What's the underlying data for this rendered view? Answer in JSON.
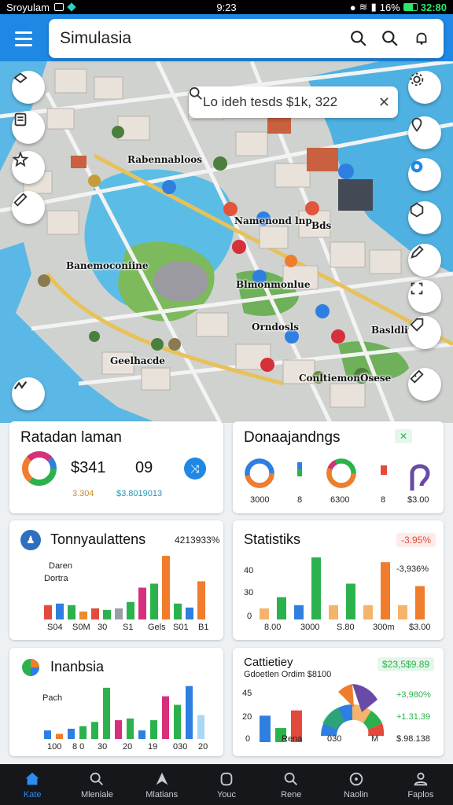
{
  "status": {
    "carrier": "Sroyulam",
    "center": "9:23",
    "battery": "16%",
    "clock": "32:80"
  },
  "app": {
    "title": "Simulasia"
  },
  "map_search": {
    "query": "Lo ideh tesds  $1k, 322"
  },
  "map_labels": {
    "l1": "Rabennabloos",
    "l2": "Namenond lnp",
    "l3": "Banemoconiine",
    "l4": "Blmonmonlue",
    "l5": "Orndosls",
    "l6": "Geelhacde",
    "l7": "Conltiemonthe",
    "l8": "Osese",
    "l9": "Basldline",
    "l10": "Bds"
  },
  "cards": {
    "radan": {
      "title": "Ratadan laman",
      "value": "$341",
      "value2": "09",
      "sub1": "3.304",
      "sub2": "$3.8019013"
    },
    "dona": {
      "title": "Donaajandngs",
      "labels": [
        "3000",
        "8",
        "6300",
        "8",
        "$3.00"
      ]
    },
    "tonny": {
      "title": "Tonnyaulattens",
      "chip": "4213933%",
      "legend1": "Daren",
      "legend2": "Dortra",
      "xlabels": [
        "S04",
        "S0M",
        "30",
        "S1",
        "Gels",
        "S01",
        "B1"
      ]
    },
    "stats": {
      "title": "Statistiks",
      "chip": "-3.95%",
      "pct": "-3,936%",
      "ylabels": [
        "40",
        "30",
        "0"
      ],
      "xlabels": [
        "8.00",
        "3000",
        "S.80",
        "300m",
        "$3.00"
      ]
    },
    "indon": {
      "title": "Inanbsia",
      "ylabel": "Pach",
      "xlabels": [
        "100",
        "8 0",
        "30",
        "20",
        "19",
        "030",
        "20"
      ]
    },
    "catt": {
      "title": "Cattietiey",
      "sub": "Gdoetlen Ordim $8100",
      "chip": "$23,5$9.89",
      "ylabels": [
        "45",
        "20",
        "0"
      ],
      "xlabels": [
        "Rena",
        "030",
        "M"
      ],
      "pcts": [
        "+3,980%",
        "+1.31.39",
        "$.98.138"
      ]
    }
  },
  "chart_data": [
    {
      "type": "bar",
      "title": "Tonnyaulattens",
      "series": [
        {
          "values": [
            18,
            20,
            18,
            10,
            14,
            12,
            14,
            22,
            40,
            45,
            80,
            20,
            15,
            48
          ]
        }
      ],
      "colors": [
        "#e24b3b",
        "#2f7fe0",
        "#2bb24c",
        "#e88c2c",
        "#e24b3b",
        "#2bb24c",
        "#9a9fa7",
        "#2bb24c",
        "#d62f7c",
        "#2bb24c",
        "#f07c2c",
        "#2bb24c",
        "#2f7fe0",
        "#f07c2c"
      ]
    },
    {
      "type": "bar",
      "title": "Statistiks",
      "series": [
        {
          "values": [
            14,
            28,
            18,
            78,
            18,
            45,
            18,
            72,
            18,
            42
          ]
        }
      ],
      "colors": [
        "#f6b36b",
        "#2bb24c",
        "#2f7fe0",
        "#2bb24c",
        "#f6b36b",
        "#2bb24c",
        "#f6b36b",
        "#f07c2c",
        "#f6b36b",
        "#f07c2c"
      ]
    },
    {
      "type": "bar",
      "title": "Inanbsia",
      "series": [
        {
          "values": [
            10,
            6,
            12,
            15,
            20,
            60,
            22,
            24,
            10,
            22,
            50,
            40,
            62,
            28
          ]
        }
      ],
      "colors": [
        "#2f7fe0",
        "#f07c2c",
        "#2f7fe0",
        "#2bb24c",
        "#2bb24c",
        "#2bb24c",
        "#d62f7c",
        "#2bb24c",
        "#2f7fe0",
        "#2bb24c",
        "#d62f7c",
        "#2bb24c",
        "#2f7fe0",
        "#a9d7f7"
      ]
    },
    {
      "type": "bar",
      "title": "Cattietiey",
      "series": [
        {
          "values": [
            15,
            8,
            18
          ]
        }
      ],
      "colors": [
        "#2f7fe0",
        "#2bb24c",
        "#e24b3b"
      ]
    }
  ]
}
